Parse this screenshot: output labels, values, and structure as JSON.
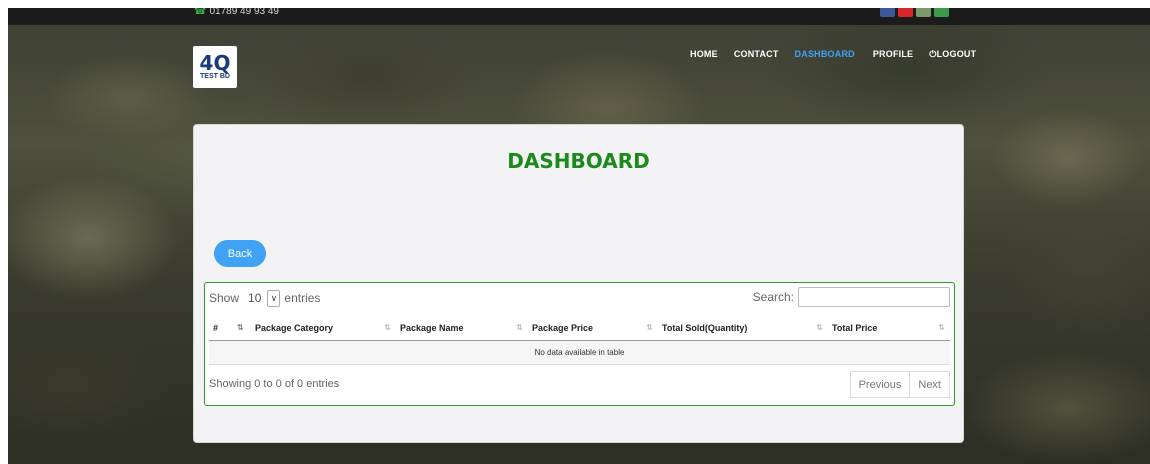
{
  "topbar": {
    "phone": "01789 49 93 49",
    "socials": [
      "facebook-icon",
      "youtube-icon",
      "twitter-icon",
      "whatsapp-icon"
    ]
  },
  "logo": {
    "mark": "4Q",
    "sub": "TEST BD"
  },
  "nav": {
    "items": [
      {
        "label": "HOME",
        "active": false
      },
      {
        "label": "CONTACT",
        "active": false
      },
      {
        "label": "DASHBOARD",
        "active": true
      },
      {
        "label": "PROFILE",
        "active": false
      },
      {
        "label": "LOGOUT",
        "icon": "power-icon",
        "active": false
      }
    ]
  },
  "page": {
    "title": "DASHBOARD",
    "back_label": "Back"
  },
  "table": {
    "show_label": "Show",
    "entries_label": "entries",
    "page_length": "10",
    "search_label": "Search:",
    "search_value": "",
    "columns": [
      "#",
      "Package Category",
      "Package Name",
      "Package Price",
      "Total Sold(Quantity)",
      "Total Price"
    ],
    "empty_message": "No data available in table",
    "info": "Showing 0 to 0 of 0 entries",
    "prev_label": "Previous",
    "next_label": "Next"
  },
  "colors": {
    "accent": "#3fa2f5",
    "title_green": "#1a8a1a",
    "border_green": "#2e9a2e"
  }
}
